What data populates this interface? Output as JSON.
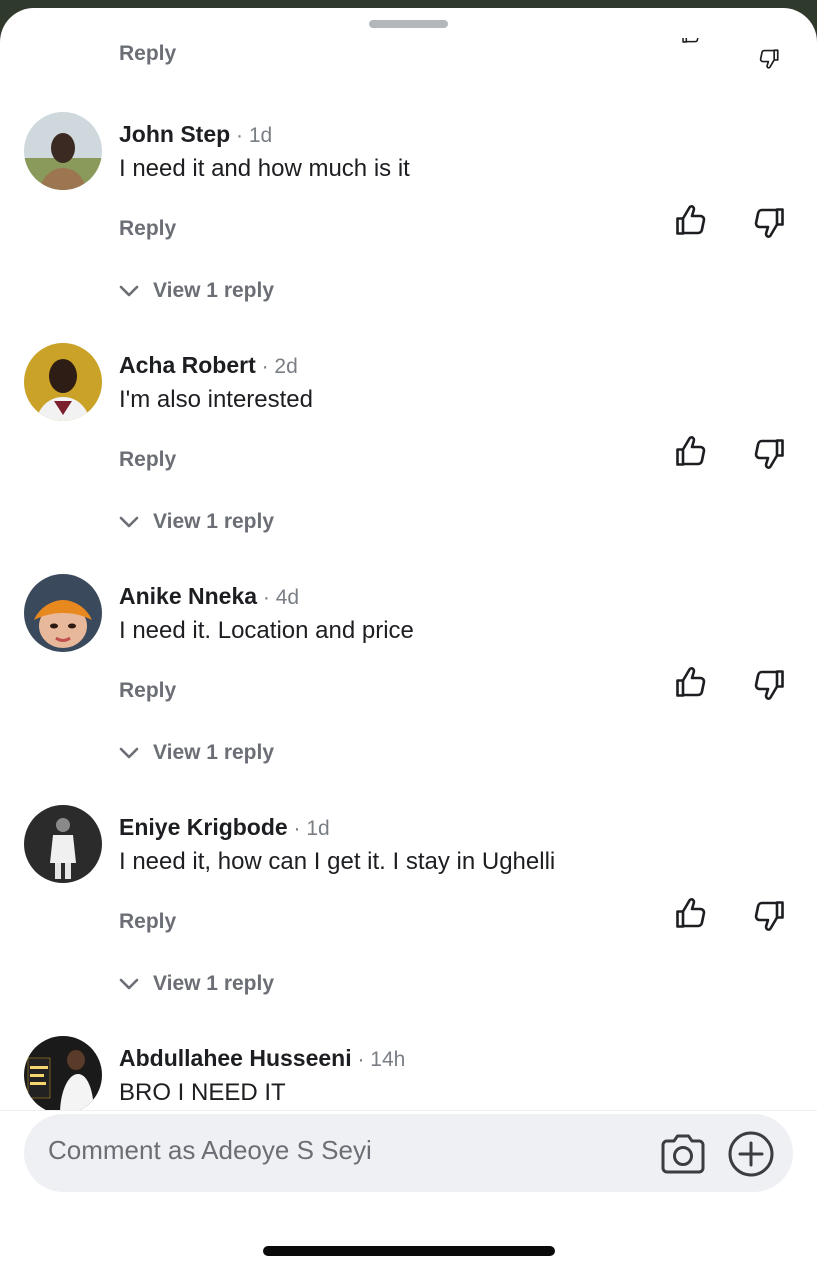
{
  "comments": [
    {
      "author": "John Step",
      "time": " · 1d",
      "text": "I need it and how much is it",
      "reply_label": "Reply",
      "view_replies": "View 1 reply"
    },
    {
      "author": "Acha Robert",
      "time": " · 2d",
      "text": "I'm also interested",
      "reply_label": "Reply",
      "view_replies": "View 1 reply"
    },
    {
      "author": "Anike Nneka",
      "time": " · 4d",
      "text": "I need it. Location and price",
      "reply_label": "Reply",
      "view_replies": "View 1 reply"
    },
    {
      "author": "Eniye Krigbode",
      "time": " · 1d",
      "text": "I need it, how can I get it. I stay in Ughelli",
      "reply_label": "Reply",
      "view_replies": "View 1 reply"
    },
    {
      "author": "Abdullahee Husseeni",
      "time": " · 14h",
      "text": "BRO I NEED IT"
    }
  ],
  "top_partial": {
    "reply_label": "Reply"
  },
  "composer": {
    "placeholder": "Comment as Adeoye S Seyi"
  },
  "icons": {
    "like": "thumbs-up-icon",
    "dislike": "thumbs-down-icon",
    "camera": "camera-icon",
    "add": "plus-circle-icon",
    "expand": "chevron-down-icon"
  },
  "colors": {
    "text": "#1c1e21",
    "muted": "#6b6f75",
    "composer_bg": "#eff0f4"
  }
}
